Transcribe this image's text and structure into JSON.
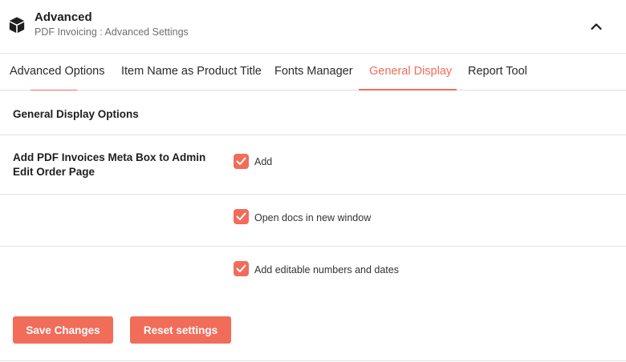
{
  "header": {
    "title": "Advanced",
    "subtitle": "PDF Invoicing : Advanced Settings",
    "icon": "cube-icon",
    "toggle_icon": "chevron-up-icon"
  },
  "tabs": [
    {
      "label": "Advanced Options",
      "active": false
    },
    {
      "label": "Item Name as Product Title",
      "active": false
    },
    {
      "label": "Fonts Manager",
      "active": false
    },
    {
      "label": "General Display",
      "active": true
    },
    {
      "label": "Report Tool",
      "active": false
    }
  ],
  "section": {
    "title": "General Display Options",
    "row_label": "Add PDF Invoices Meta Box to Admin Edit Order Page",
    "options": [
      {
        "label": "Add",
        "checked": true
      },
      {
        "label": "Open docs in new window",
        "checked": true
      },
      {
        "label": "Add editable numbers and dates",
        "checked": true
      }
    ]
  },
  "buttons": {
    "save": "Save Changes",
    "reset": "Reset settings"
  },
  "colors": {
    "accent": "#f26c5a",
    "text": "#1e1e1e",
    "muted": "#6f6f6f",
    "divider": "#e4e4e4"
  }
}
